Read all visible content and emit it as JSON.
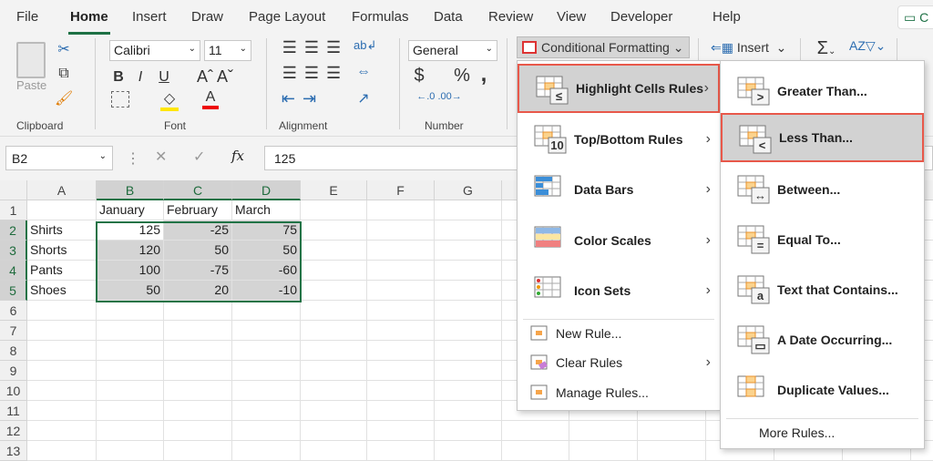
{
  "menubar": {
    "tabs": [
      "File",
      "Home",
      "Insert",
      "Draw",
      "Page Layout",
      "Formulas",
      "Data",
      "Review",
      "View",
      "Developer",
      "Help"
    ],
    "active": "Home",
    "comments_label": "C"
  },
  "ribbon": {
    "clipboard": {
      "label": "Clipboard",
      "paste": "Paste"
    },
    "font": {
      "label": "Font",
      "name": "Calibri",
      "size": "11",
      "bold": "B",
      "italic": "I",
      "underline": "U"
    },
    "alignment": {
      "label": "Alignment"
    },
    "number": {
      "label": "Number",
      "format": "General",
      "currency": "$",
      "percent": "%",
      "comma": ","
    },
    "styles": {
      "conditional_formatting": "Conditional Formatting"
    },
    "cells": {
      "insert": "Insert"
    },
    "editing": {
      "sum": "Σ"
    }
  },
  "formula_bar": {
    "name_box": "B2",
    "fx": "fx",
    "value": "125"
  },
  "sheet": {
    "columns": [
      "A",
      "B",
      "C",
      "D",
      "E",
      "F",
      "G"
    ],
    "rows": [
      "1",
      "2",
      "3",
      "4",
      "5",
      "6",
      "7",
      "8",
      "9",
      "10",
      "11",
      "12",
      "13"
    ],
    "header_row": [
      "",
      "January",
      "February",
      "March"
    ],
    "data": [
      [
        "Shirts",
        "125",
        "-25",
        "75"
      ],
      [
        "Shorts",
        "120",
        "50",
        "50"
      ],
      [
        "Pants",
        "100",
        "-75",
        "-60"
      ],
      [
        "Shoes",
        "50",
        "20",
        "-10"
      ]
    ]
  },
  "cf_menu": {
    "items": [
      {
        "label": "Highlight Cells Rules",
        "key": "H",
        "rest": "ighlight Cells Rules",
        "submenu": true
      },
      {
        "label": "Top/Bottom Rules",
        "key": "T",
        "rest": "op/Bottom Rules",
        "submenu": true
      },
      {
        "label": "Data Bars",
        "key": "D",
        "rest": "ata Bars",
        "submenu": true
      },
      {
        "label": "Color Scales",
        "key": "S",
        "rest": "",
        "submenu": true
      },
      {
        "label": "Icon Sets",
        "key": "I",
        "rest": "con Sets",
        "submenu": true
      }
    ],
    "small_items": [
      {
        "label": "New Rule...",
        "submenu": false
      },
      {
        "label": "Clear Rules",
        "submenu": true
      },
      {
        "label": "Manage Rules...",
        "submenu": false
      }
    ]
  },
  "highlight_submenu": {
    "items": [
      "Greater Than...",
      "Less Than...",
      "Between...",
      "Equal To...",
      "Text that Contains...",
      "A Date Occurring...",
      "Duplicate Values..."
    ],
    "symbols": [
      ">",
      "<",
      "",
      "=",
      "a",
      "",
      ""
    ],
    "more": "More Rules..."
  }
}
